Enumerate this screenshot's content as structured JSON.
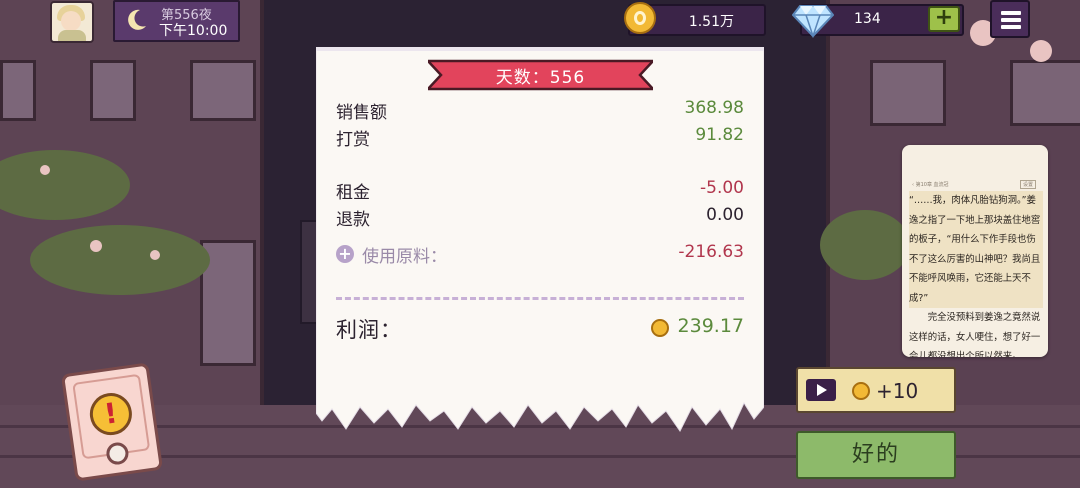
{
  "hud": {
    "day_label": "第556夜",
    "time_label": "下午10:00",
    "coins": "1.51万",
    "gems": "134",
    "plus_label": "+"
  },
  "receipt": {
    "banner": "天数：556",
    "rows": [
      {
        "label": "销售额",
        "value": "368.98"
      },
      {
        "label": "打赏",
        "value": "91.82"
      },
      {
        "label": "租金",
        "value": "-5.00"
      },
      {
        "label": "退款",
        "value": "0.00"
      }
    ],
    "ingredients_label": "使用原料：",
    "ingredients_value": "-216.63",
    "profit_label": "利润：",
    "profit_value": "239.17"
  },
  "novel": {
    "header_left": "‹ 第10章 血流冠",
    "header_right": "设置",
    "paragraphs": [
      "“……我，肉体凡胎钻狗洞。”姜逸之指了一下地上那块盖住地窖的板子，“用什么下作手段也伤不了这么厉害的山神吧？我尚且不能呼风唤雨，它还能上天不成?”",
      "完全没预料到姜逸之竟然说这样的话，女人哽住，想了好一会儿都没想出个所以然来。"
    ]
  },
  "buttons": {
    "video_reward": "+10",
    "ok": "好的"
  },
  "alert": {
    "symbol": "!"
  },
  "colors": {
    "positive": "#5b8a3c",
    "negative": "#b1364d",
    "banner": "#e2445c",
    "ok_button": "#8dba6a"
  }
}
